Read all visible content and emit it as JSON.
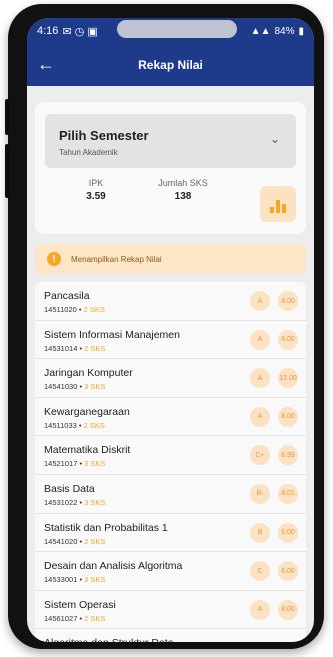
{
  "status": {
    "time": "4:16",
    "battery": "84%"
  },
  "appbar": {
    "title": "Rekap Nilai"
  },
  "semester": {
    "title": "Pilih Semester",
    "subtitle": "Tahun Akademik"
  },
  "stats": {
    "ipk_label": "IPK",
    "ipk_value": "3.59",
    "sks_label": "Jumlah SKS",
    "sks_value": "138"
  },
  "info": {
    "text": "Menampilkan Rekap Nilai"
  },
  "courses": [
    {
      "name": "Pancasila",
      "code": "14511020",
      "sks": "2 SKS",
      "grade": "A",
      "score": "8.00"
    },
    {
      "name": "Sistem Informasi Manajemen",
      "code": "14531014",
      "sks": "2 SKS",
      "grade": "A",
      "score": "8.00"
    },
    {
      "name": "Jaringan Komputer",
      "code": "14541030",
      "sks": "3 SKS",
      "grade": "A",
      "score": "12.00"
    },
    {
      "name": "Kewarganegaraan",
      "code": "14511033",
      "sks": "2 SKS",
      "grade": "A",
      "score": "8.00"
    },
    {
      "name": "Matematika Diskrit",
      "code": "14521017",
      "sks": "3 SKS",
      "grade": "C+",
      "score": "6.99"
    },
    {
      "name": "Basis Data",
      "code": "14531022",
      "sks": "3 SKS",
      "grade": "B-",
      "score": "8.01"
    },
    {
      "name": "Statistik dan Probabilitas 1",
      "code": "14541020",
      "sks": "2 SKS",
      "grade": "B",
      "score": "6.00"
    },
    {
      "name": "Desain dan Analisis Algoritma",
      "code": "14533001",
      "sks": "3 SKS",
      "grade": "C",
      "score": "6.00"
    },
    {
      "name": "Sistem Operasi",
      "code": "14561027",
      "sks": "2 SKS",
      "grade": "A",
      "score": "8.00"
    },
    {
      "name": "Algoritma dan Struktur Data",
      "code": "",
      "sks": "",
      "grade": "",
      "score": ""
    }
  ],
  "colors": {
    "primary": "#1e3a8a",
    "accent": "#f5a623",
    "badge_bg": "#fbe2c2"
  }
}
